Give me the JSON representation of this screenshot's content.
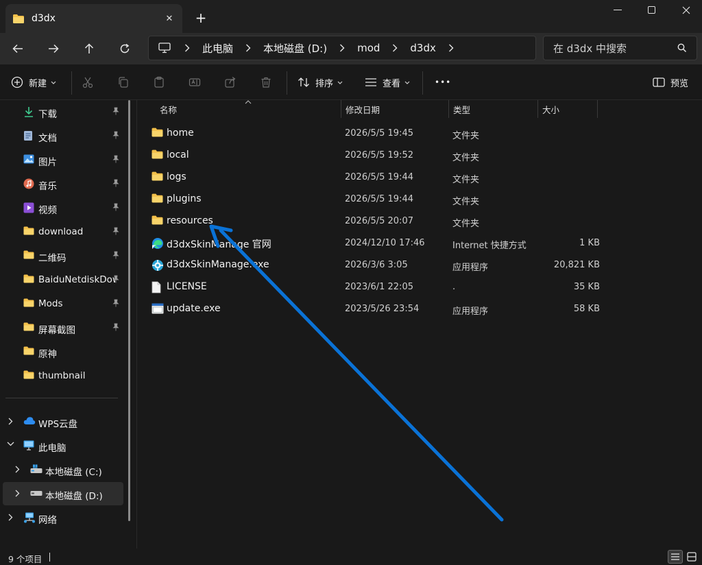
{
  "window": {
    "tab_title": "d3dx",
    "close_tab_symbol": "✕",
    "new_tab_symbol": "+"
  },
  "address": {
    "crumbs": [
      "此电脑",
      "本地磁盘 (D:)",
      "mod",
      "d3dx"
    ]
  },
  "search": {
    "placeholder": "在 d3dx 中搜索"
  },
  "commands": {
    "new_label": "新建",
    "sort_label": "排序",
    "view_label": "查看",
    "more_label": "•••",
    "preview_label": "预览"
  },
  "sidebar": {
    "quick_access": [
      {
        "label": "下载",
        "icon": "download-icon"
      },
      {
        "label": "文档",
        "icon": "document-icon"
      },
      {
        "label": "图片",
        "icon": "pictures-icon"
      },
      {
        "label": "音乐",
        "icon": "music-icon"
      },
      {
        "label": "视频",
        "icon": "video-icon"
      },
      {
        "label": "download",
        "icon": "folder-icon"
      },
      {
        "label": "二维码",
        "icon": "folder-icon"
      },
      {
        "label": "BaiduNetdiskDow",
        "icon": "folder-icon"
      },
      {
        "label": "Mods",
        "icon": "folder-icon"
      },
      {
        "label": "屏幕截图",
        "icon": "folder-icon"
      },
      {
        "label": "原神",
        "icon": "folder-icon"
      },
      {
        "label": "thumbnail",
        "icon": "folder-icon"
      }
    ],
    "tree": [
      {
        "label": "WPS云盘",
        "icon": "cloud-icon"
      },
      {
        "label": "此电脑",
        "icon": "pc-icon"
      },
      {
        "label": "本地磁盘 (C:)",
        "icon": "drive-icon"
      },
      {
        "label": "本地磁盘 (D:)",
        "icon": "drive-icon"
      },
      {
        "label": "网络",
        "icon": "network-icon"
      }
    ]
  },
  "columns": {
    "name": "名称",
    "modified": "修改日期",
    "type": "类型",
    "size": "大小"
  },
  "files": [
    {
      "name": "home",
      "date": "2026/5/5 19:45",
      "type": "文件夹",
      "size": "",
      "icon": "folder-icon"
    },
    {
      "name": "local",
      "date": "2026/5/5 19:52",
      "type": "文件夹",
      "size": "",
      "icon": "folder-icon"
    },
    {
      "name": "logs",
      "date": "2026/5/5 19:44",
      "type": "文件夹",
      "size": "",
      "icon": "folder-icon"
    },
    {
      "name": "plugins",
      "date": "2026/5/5 19:44",
      "type": "文件夹",
      "size": "",
      "icon": "folder-icon"
    },
    {
      "name": "resources",
      "date": "2026/5/5 20:07",
      "type": "文件夹",
      "size": "",
      "icon": "folder-icon"
    },
    {
      "name": "d3dxSkinManage 官网",
      "date": "2024/12/10 17:46",
      "type": "Internet 快捷方式",
      "size": "1 KB",
      "icon": "edge-shortcut-icon"
    },
    {
      "name": "d3dxSkinManage.exe",
      "date": "2026/3/6 3:05",
      "type": "应用程序",
      "size": "20,821 KB",
      "icon": "app-icon"
    },
    {
      "name": "LICENSE",
      "date": "2023/6/1 22:05",
      "type": ".",
      "size": "35 KB",
      "icon": "file-icon"
    },
    {
      "name": "update.exe",
      "date": "2023/5/26 23:54",
      "type": "应用程序",
      "size": "58 KB",
      "icon": "window-app-icon"
    }
  ],
  "status": {
    "count": "9 个项目"
  },
  "colors": {
    "accent": "#0078d4",
    "folder": "#f3c04a",
    "background": "#191919"
  }
}
